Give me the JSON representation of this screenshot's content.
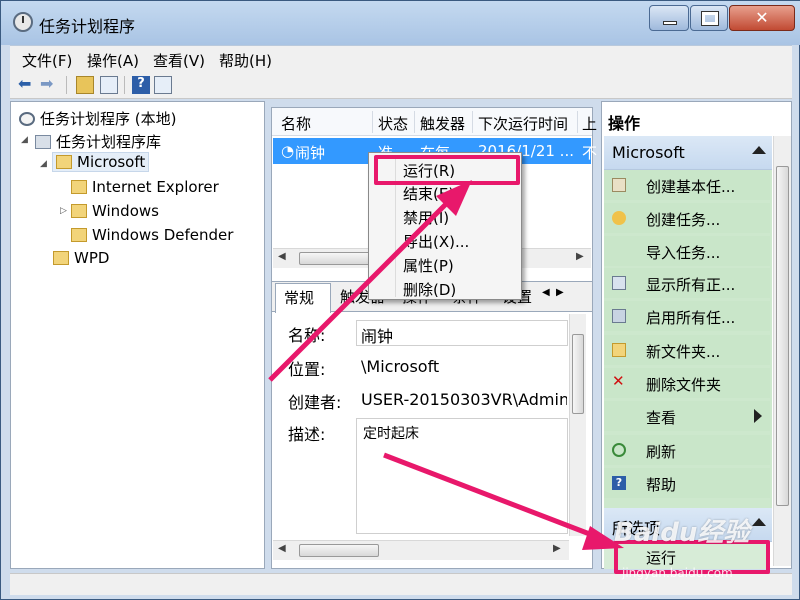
{
  "window": {
    "title": "任务计划程序"
  },
  "menu": [
    "文件(F)",
    "操作(A)",
    "查看(V)",
    "帮助(H)"
  ],
  "tree": {
    "root": "任务计划程序 (本地)",
    "library": "任务计划程序库",
    "microsoft": "Microsoft",
    "children": [
      "Internet Explorer",
      "Windows",
      "Windows Defender"
    ],
    "wpd": "WPD"
  },
  "task_list": {
    "columns": [
      "名称",
      "状态",
      "触发器",
      "下次运行时间",
      "上"
    ],
    "row": [
      "闹钟",
      "准...",
      "在每...",
      "2016/1/21 ...",
      "不"
    ]
  },
  "context_menu": [
    "运行(R)",
    "结束(E)",
    "禁用(I)",
    "导出(X)...",
    "属性(P)",
    "删除(D)"
  ],
  "detail": {
    "tabs": [
      "常规",
      "触发器",
      "操作",
      "条件",
      "设置"
    ],
    "labels": [
      "名称:",
      "位置:",
      "创建者:",
      "描述:"
    ],
    "values": [
      "闹钟",
      "\\Microsoft",
      "USER-20150303VR\\Admin",
      "定时起床"
    ]
  },
  "actions": {
    "title": "操作",
    "section1": "Microsoft",
    "items": [
      "创建基本任...",
      "创建任务...",
      "导入任务...",
      "显示所有正...",
      "启用所有任...",
      "新文件夹...",
      "删除文件夹",
      "查看",
      "刷新",
      "帮助"
    ],
    "section2": "所选项",
    "run": "运行"
  },
  "watermark": {
    "brand": "Baidu经验",
    "url": "jingyan.baidu.com"
  },
  "colors": {
    "highlight": "#e8186b",
    "selection": "#3399ff",
    "action_bg": "#cde8cd"
  }
}
